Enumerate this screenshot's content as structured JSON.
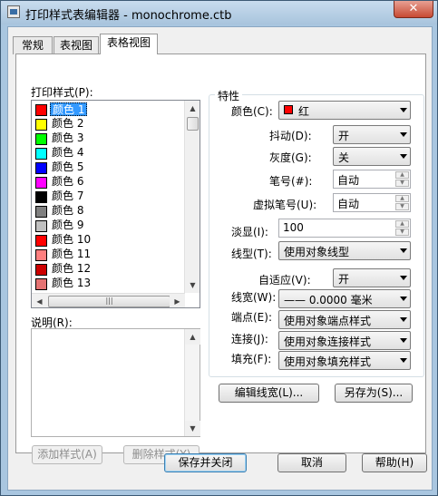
{
  "window": {
    "title": "打印样式表编辑器 - monochrome.ctb",
    "close_glyph": "✕"
  },
  "tabs": [
    {
      "label": "常规"
    },
    {
      "label": "表视图"
    },
    {
      "label": "表格视图"
    }
  ],
  "left": {
    "styles_label": "打印样式(P):",
    "styles": [
      {
        "label": "颜色 1",
        "color": "#ff0000"
      },
      {
        "label": "颜色 2",
        "color": "#ffff00"
      },
      {
        "label": "颜色 3",
        "color": "#00ff00"
      },
      {
        "label": "颜色 4",
        "color": "#00ffff"
      },
      {
        "label": "颜色 5",
        "color": "#0000ff"
      },
      {
        "label": "颜色 6",
        "color": "#ff00ff"
      },
      {
        "label": "颜色 7",
        "color": "#000000"
      },
      {
        "label": "颜色 8",
        "color": "#808080"
      },
      {
        "label": "颜色 9",
        "color": "#c0c0c0"
      },
      {
        "label": "颜色 10",
        "color": "#ff0000"
      },
      {
        "label": "颜色 11",
        "color": "#ff7f7f"
      },
      {
        "label": "颜色 12",
        "color": "#cc0000"
      },
      {
        "label": "颜色 13",
        "color": "#e57373"
      }
    ],
    "description_label": "说明(R):",
    "add_style": "添加样式(A)",
    "delete_style": "删除样式(Y)"
  },
  "properties": {
    "group_title": "特性",
    "color_label": "颜色(C):",
    "color_value": "红",
    "dither_label": "抖动(D):",
    "dither_value": "开",
    "grayscale_label": "灰度(G):",
    "grayscale_value": "关",
    "pen_label": "笔号(#):",
    "pen_value": "自动",
    "vpen_label": "虚拟笔号(U):",
    "vpen_value": "自动",
    "screening_label": "淡显(I):",
    "screening_value": "100",
    "linetype_label": "线型(T):",
    "linetype_value": "使用对象线型",
    "adaptive_label": "自适应(V):",
    "adaptive_value": "开",
    "lineweight_label": "线宽(W):",
    "lineweight_value": "—— 0.0000 毫米",
    "endstyle_label": "端点(E):",
    "endstyle_value": "使用对象端点样式",
    "joinstyle_label": "连接(J):",
    "joinstyle_value": "使用对象连接样式",
    "fill_label": "填充(F):",
    "fill_value": "使用对象填充样式",
    "edit_lineweights": "编辑线宽(L)...",
    "save_as": "另存为(S)..."
  },
  "footer": {
    "save_close": "保存并关闭",
    "cancel": "取消",
    "help": "帮助(H)"
  }
}
